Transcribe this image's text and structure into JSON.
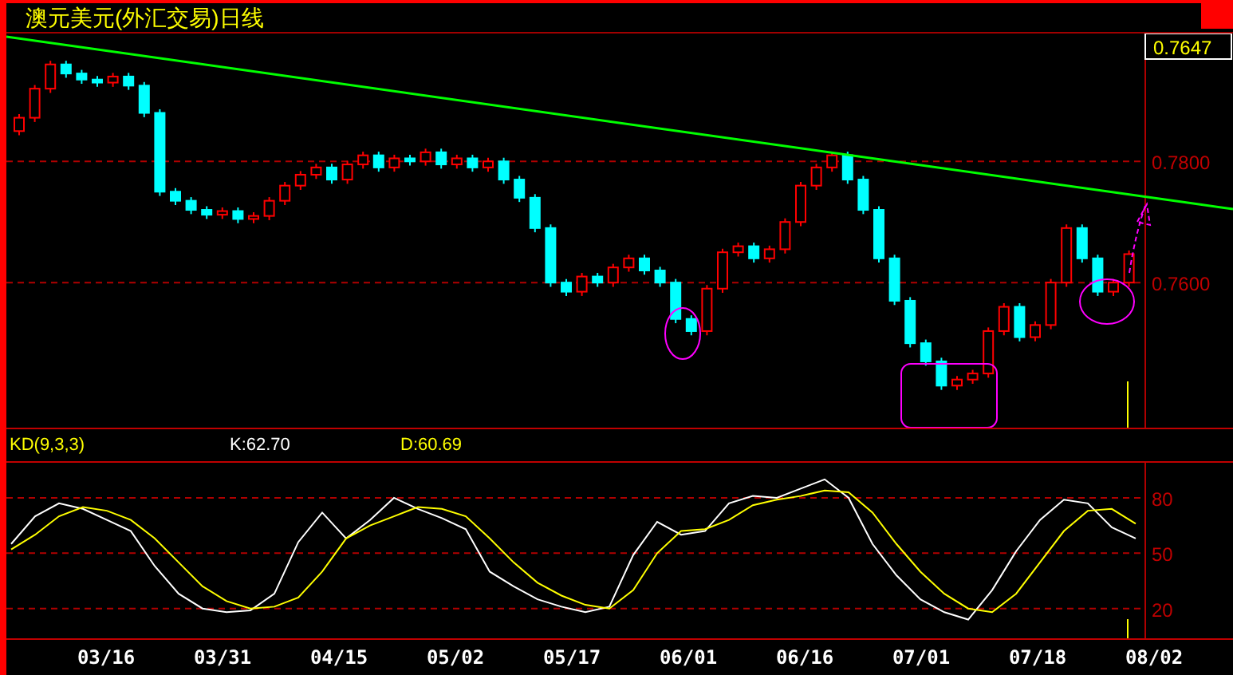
{
  "title": "澳元美元(外汇交易)日线",
  "price_panel": {
    "current_price": "0.7647",
    "chart_data": {
      "type": "candlestick",
      "ylim": [
        0.7358,
        0.8011
      ],
      "yticks": [
        {
          "value": 0.76,
          "label": "0.7600"
        },
        {
          "value": 0.78,
          "label": "0.7800"
        }
      ],
      "grid": true,
      "ohlc": [
        [
          0.785,
          0.7878,
          0.7843,
          0.7872
        ],
        [
          0.7872,
          0.7926,
          0.7865,
          0.792
        ],
        [
          0.792,
          0.7966,
          0.7913,
          0.796
        ],
        [
          0.796,
          0.7966,
          0.7938,
          0.7945
        ],
        [
          0.7945,
          0.7951,
          0.7928,
          0.7935
        ],
        [
          0.7935,
          0.7941,
          0.7923,
          0.793
        ],
        [
          0.793,
          0.7946,
          0.7923,
          0.794
        ],
        [
          0.794,
          0.7946,
          0.7918,
          0.7925
        ],
        [
          0.7925,
          0.7931,
          0.7873,
          0.788
        ],
        [
          0.788,
          0.7886,
          0.7743,
          0.775
        ],
        [
          0.775,
          0.7756,
          0.7728,
          0.7735
        ],
        [
          0.7735,
          0.7741,
          0.7713,
          0.772
        ],
        [
          0.772,
          0.7726,
          0.7705,
          0.7712
        ],
        [
          0.7712,
          0.7724,
          0.7705,
          0.7718
        ],
        [
          0.7718,
          0.7724,
          0.7698,
          0.7705
        ],
        [
          0.7705,
          0.7716,
          0.7698,
          0.771
        ],
        [
          0.771,
          0.7741,
          0.7703,
          0.7735
        ],
        [
          0.7735,
          0.7766,
          0.7728,
          0.776
        ],
        [
          0.776,
          0.7784,
          0.7753,
          0.7778
        ],
        [
          0.7778,
          0.7796,
          0.7771,
          0.779
        ],
        [
          0.779,
          0.7796,
          0.7763,
          0.777
        ],
        [
          0.777,
          0.7801,
          0.7763,
          0.7795
        ],
        [
          0.7795,
          0.7816,
          0.7788,
          0.781
        ],
        [
          0.781,
          0.7816,
          0.7783,
          0.779
        ],
        [
          0.779,
          0.7811,
          0.7783,
          0.7805
        ],
        [
          0.7805,
          0.7811,
          0.7793,
          0.78
        ],
        [
          0.78,
          0.7821,
          0.7793,
          0.7815
        ],
        [
          0.7815,
          0.7821,
          0.7788,
          0.7795
        ],
        [
          0.7795,
          0.7811,
          0.7788,
          0.7805
        ],
        [
          0.7805,
          0.7811,
          0.7783,
          0.779
        ],
        [
          0.779,
          0.7806,
          0.7783,
          0.78
        ],
        [
          0.78,
          0.7806,
          0.7763,
          0.777
        ],
        [
          0.777,
          0.7776,
          0.7733,
          0.774
        ],
        [
          0.774,
          0.7746,
          0.7683,
          0.769
        ],
        [
          0.769,
          0.7696,
          0.7593,
          0.76
        ],
        [
          0.76,
          0.7606,
          0.7578,
          0.7585
        ],
        [
          0.7585,
          0.7616,
          0.7578,
          0.761
        ],
        [
          0.761,
          0.7616,
          0.7593,
          0.76
        ],
        [
          0.76,
          0.7631,
          0.7593,
          0.7625
        ],
        [
          0.7625,
          0.7646,
          0.7618,
          0.764
        ],
        [
          0.764,
          0.7646,
          0.7613,
          0.762
        ],
        [
          0.762,
          0.7626,
          0.7593,
          0.76
        ],
        [
          0.76,
          0.7606,
          0.7533,
          0.754
        ],
        [
          0.754,
          0.7546,
          0.7513,
          0.752
        ],
        [
          0.752,
          0.7596,
          0.7513,
          0.759
        ],
        [
          0.759,
          0.7656,
          0.7583,
          0.765
        ],
        [
          0.765,
          0.7666,
          0.7643,
          0.766
        ],
        [
          0.766,
          0.7666,
          0.7633,
          0.764
        ],
        [
          0.764,
          0.7661,
          0.7633,
          0.7655
        ],
        [
          0.7655,
          0.7706,
          0.7648,
          0.77
        ],
        [
          0.77,
          0.7766,
          0.7693,
          0.776
        ],
        [
          0.776,
          0.7796,
          0.7753,
          0.779
        ],
        [
          0.779,
          0.7816,
          0.7783,
          0.781
        ],
        [
          0.781,
          0.7816,
          0.7763,
          0.777
        ],
        [
          0.777,
          0.7776,
          0.7713,
          0.772
        ],
        [
          0.772,
          0.7726,
          0.7633,
          0.764
        ],
        [
          0.764,
          0.7646,
          0.7563,
          0.757
        ],
        [
          0.757,
          0.7576,
          0.7493,
          0.75
        ],
        [
          0.75,
          0.7506,
          0.7463,
          0.747
        ],
        [
          0.747,
          0.7476,
          0.7423,
          0.743
        ],
        [
          0.743,
          0.7446,
          0.7423,
          0.744
        ],
        [
          0.744,
          0.7456,
          0.7433,
          0.745
        ],
        [
          0.745,
          0.7526,
          0.7443,
          0.752
        ],
        [
          0.752,
          0.7566,
          0.7513,
          0.756
        ],
        [
          0.756,
          0.7566,
          0.7503,
          0.751
        ],
        [
          0.751,
          0.7536,
          0.7503,
          0.753
        ],
        [
          0.753,
          0.7606,
          0.7523,
          0.76
        ],
        [
          0.76,
          0.7696,
          0.7593,
          0.769
        ],
        [
          0.769,
          0.7696,
          0.7633,
          0.764
        ],
        [
          0.764,
          0.7646,
          0.7578,
          0.7585
        ],
        [
          0.7585,
          0.7606,
          0.7578,
          0.76
        ],
        [
          0.76,
          0.7653,
          0.7593,
          0.7647
        ]
      ]
    }
  },
  "dates": [
    "03/16",
    "03/31",
    "04/15",
    "05/02",
    "05/17",
    "06/01",
    "06/16",
    "07/01",
    "07/18",
    "08/02"
  ],
  "indicator": {
    "name": "KD(9,3,3)",
    "k": "K:62.70",
    "d": "D:60.69"
  },
  "kd_panel": {
    "chart_data": {
      "type": "line",
      "grid": true,
      "ylim": [
        3,
        99
      ],
      "yticks": [
        20,
        50,
        80
      ],
      "series": [
        {
          "color": "#ffffff",
          "values": [
            55,
            70,
            77,
            74,
            68,
            62,
            43,
            28,
            20,
            18,
            19,
            28,
            56,
            72,
            58,
            68,
            80,
            74,
            69,
            63,
            40,
            32,
            25,
            21,
            18,
            21,
            49,
            67,
            60,
            62,
            77,
            81,
            80,
            85,
            90,
            80,
            55,
            38,
            25,
            18,
            14,
            30,
            51,
            68,
            79,
            77,
            64,
            58
          ]
        },
        {
          "color": "#ffff00",
          "values": [
            52,
            60,
            70,
            75,
            73,
            68,
            58,
            45,
            32,
            24,
            20,
            21,
            26,
            40,
            58,
            65,
            70,
            75,
            74,
            70,
            58,
            45,
            34,
            27,
            22,
            20,
            30,
            50,
            62,
            63,
            68,
            76,
            79,
            81,
            84,
            83,
            72,
            55,
            40,
            28,
            20,
            18,
            28,
            45,
            62,
            73,
            74,
            66
          ]
        }
      ]
    }
  }
}
